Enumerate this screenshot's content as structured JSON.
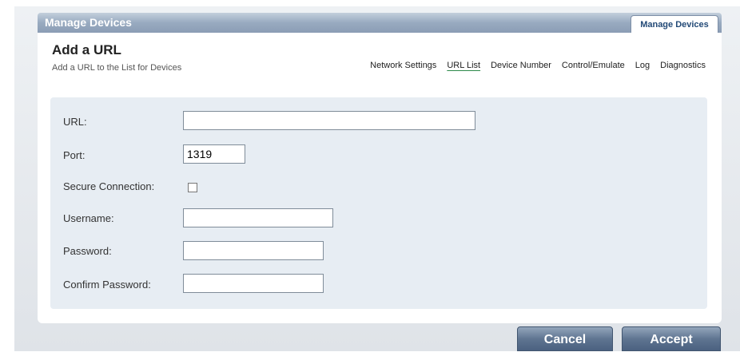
{
  "window": {
    "title": "Manage Devices",
    "active_tab": "Manage Devices"
  },
  "page": {
    "title": "Add a URL",
    "subtitle": "Add a URL to the List for Devices"
  },
  "nav": {
    "items": [
      "Network Settings",
      "URL List",
      "Device Number",
      "Control/Emulate",
      "Log",
      "Diagnostics"
    ],
    "active": "URL List"
  },
  "form": {
    "url_label": "URL:",
    "url_value": "",
    "port_label": "Port:",
    "port_value": "1319",
    "secure_label": "Secure Connection:",
    "secure_checked": false,
    "username_label": "Username:",
    "username_value": "",
    "password_label": "Password:",
    "password_value": "",
    "confirm_label": "Confirm Password:",
    "confirm_value": ""
  },
  "buttons": {
    "cancel": "Cancel",
    "accept": "Accept"
  }
}
